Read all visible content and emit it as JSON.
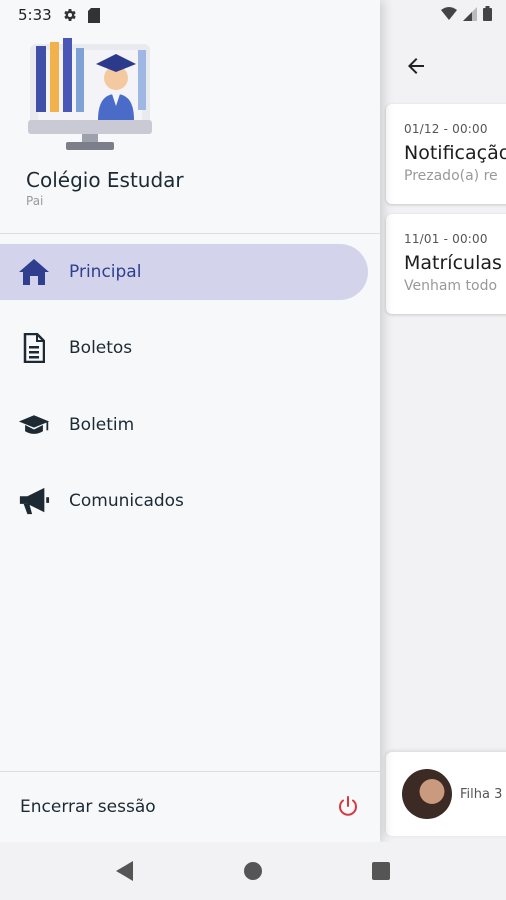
{
  "status_bar": {
    "time": "5:33"
  },
  "drawer": {
    "school_name": "Colégio Estudar",
    "user_role": "Pai",
    "menu": [
      {
        "label": "Principal",
        "icon": "home-icon",
        "active": true
      },
      {
        "label": "Boletos",
        "icon": "document-icon",
        "active": false
      },
      {
        "label": "Boletim",
        "icon": "graduation-cap-icon",
        "active": false
      },
      {
        "label": "Comunicados",
        "icon": "megaphone-icon",
        "active": false
      }
    ],
    "logout_label": "Encerrar sessão"
  },
  "background": {
    "cards": [
      {
        "date": "01/12 - 00:00",
        "title": "Notificação",
        "preview": "Prezado(a) re"
      },
      {
        "date": "11/01 - 00:00",
        "title": "Matrículas",
        "preview": "Venham todo"
      }
    ],
    "child_name": "Filha 3"
  },
  "colors": {
    "accent": "#2f3f8e",
    "active_bg": "#d3d4eb",
    "logout_icon": "#d9363e"
  }
}
